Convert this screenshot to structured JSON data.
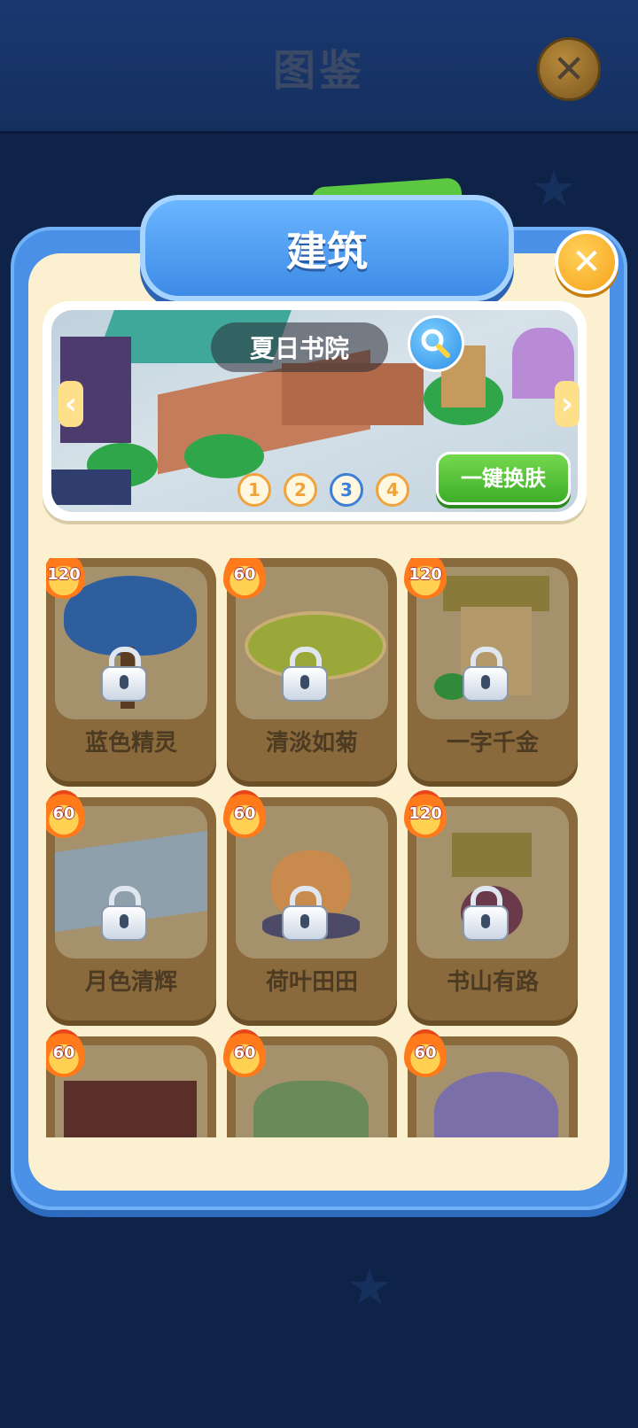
{
  "header": {
    "title": "图鉴",
    "close_icon": "close-icon"
  },
  "panel": {
    "title": "建筑",
    "close_icon": "close-icon",
    "banner": {
      "name": "夏日书院",
      "search_icon": "search-icon",
      "pages": [
        "1",
        "2",
        "3",
        "4"
      ],
      "active_page": "3",
      "skin_button": "一键换肤",
      "prev_icon": "chevron-left-icon",
      "next_icon": "chevron-right-icon"
    },
    "items": [
      {
        "name": "蓝色精灵",
        "cost": "120",
        "locked": true
      },
      {
        "name": "清淡如菊",
        "cost": "60",
        "locked": true
      },
      {
        "name": "一字千金",
        "cost": "120",
        "locked": true
      },
      {
        "name": "月色清辉",
        "cost": "60",
        "locked": true
      },
      {
        "name": "荷叶田田",
        "cost": "60",
        "locked": true
      },
      {
        "name": "书山有路",
        "cost": "120",
        "locked": true
      },
      {
        "name": "",
        "cost": "60",
        "locked": true
      },
      {
        "name": "",
        "cost": "60",
        "locked": true
      },
      {
        "name": "",
        "cost": "60",
        "locked": true
      }
    ]
  },
  "colors": {
    "panel_blue": "#4a90e6",
    "panel_cream": "#fbf0cf",
    "card_brown": "#8a6a3c",
    "skin_green": "#3fae2a"
  }
}
